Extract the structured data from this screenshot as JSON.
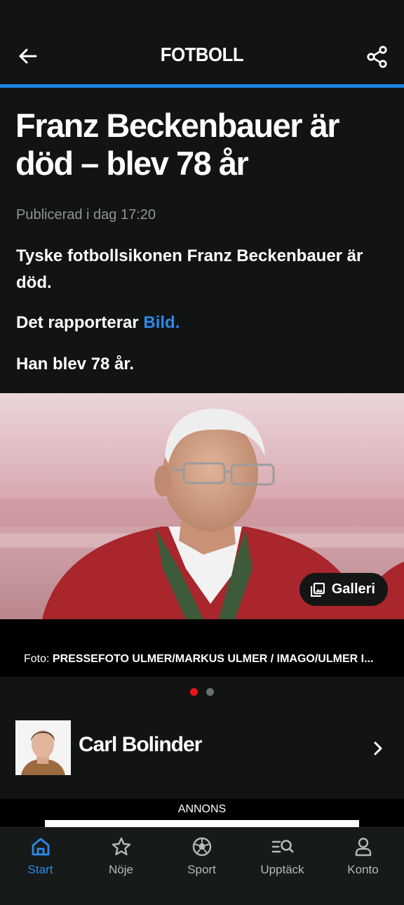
{
  "header": {
    "section": "FOTBOLL",
    "back_icon": "arrow-left-icon",
    "share_icon": "share-icon",
    "accent_color": "#1a86e8"
  },
  "article": {
    "headline": "Franz Beckenbauer är död – blev 78 år",
    "published": "Publicerad i dag 17:20",
    "paragraphs": {
      "p1": "Tyske fotbollsikonen Franz Beckenbauer är död.",
      "p2_text": "Det rapporterar ",
      "p2_link": "Bild.",
      "p3": "Han blev 78 år."
    },
    "link_color": "#2a8ae8"
  },
  "media": {
    "gallery_label": "Galleri",
    "gallery_icon": "gallery-icon",
    "caption_prefix": "Foto: ",
    "caption_credit": "PRESSEFOTO ULMER/MARKUS ULMER / IMAGO/ULMER I...",
    "carousel_dots": [
      {
        "active": true,
        "color": "#e8141a"
      },
      {
        "active": false,
        "color": "#6b6f6e"
      }
    ]
  },
  "author": {
    "name": "Carl Bolinder",
    "chevron_icon": "chevron-right-icon"
  },
  "ad": {
    "label": "ANNONS"
  },
  "tabbar": {
    "tabs": [
      {
        "label": "Start",
        "icon": "home-icon",
        "active": true
      },
      {
        "label": "Nöje",
        "icon": "star-icon",
        "active": false
      },
      {
        "label": "Sport",
        "icon": "football-icon",
        "active": false
      },
      {
        "label": "Upptäck",
        "icon": "search-list-icon",
        "active": false
      },
      {
        "label": "Konto",
        "icon": "person-icon",
        "active": false
      }
    ],
    "active_color": "#2a8ae8"
  }
}
